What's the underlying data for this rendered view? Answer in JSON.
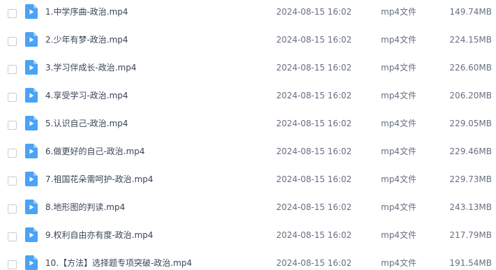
{
  "icon": "video-file-icon",
  "colors": {
    "icon_blue": "#4aa3f6",
    "icon_fold": "#9bcdfb",
    "text": "#3b4458",
    "meta_text": "#666f80"
  },
  "files": [
    {
      "name": "1.中学序曲-政治.mp4",
      "date": "2024-08-15 16:02",
      "type": "mp4文件",
      "size": "149.74MB"
    },
    {
      "name": "2.少年有梦-政治.mp4",
      "date": "2024-08-15 16:02",
      "type": "mp4文件",
      "size": "224.15MB"
    },
    {
      "name": "3.学习伴成长-政治.mp4",
      "date": "2024-08-15 16:02",
      "type": "mp4文件",
      "size": "226.60MB"
    },
    {
      "name": "4.享受学习-政治.mp4",
      "date": "2024-08-15 16:02",
      "type": "mp4文件",
      "size": "206.20MB"
    },
    {
      "name": "5.认识自己-政治.mp4",
      "date": "2024-08-15 16:02",
      "type": "mp4文件",
      "size": "229.05MB"
    },
    {
      "name": "6.做更好的自己-政治.mp4",
      "date": "2024-08-15 16:02",
      "type": "mp4文件",
      "size": "229.46MB"
    },
    {
      "name": "7.祖国花朵需呵护-政治.mp4",
      "date": "2024-08-15 16:02",
      "type": "mp4文件",
      "size": "229.73MB"
    },
    {
      "name": "8.地形图的判读.mp4",
      "date": "2024-08-15 16:02",
      "type": "mp4文件",
      "size": "243.13MB"
    },
    {
      "name": "9.权利自由亦有度-政治.mp4",
      "date": "2024-08-15 16:02",
      "type": "mp4文件",
      "size": "217.79MB"
    },
    {
      "name": "10.【方法】选择题专项突破-政治.mp4",
      "date": "2024-08-15 16:02",
      "type": "mp4文件",
      "size": "191.54MB"
    }
  ]
}
